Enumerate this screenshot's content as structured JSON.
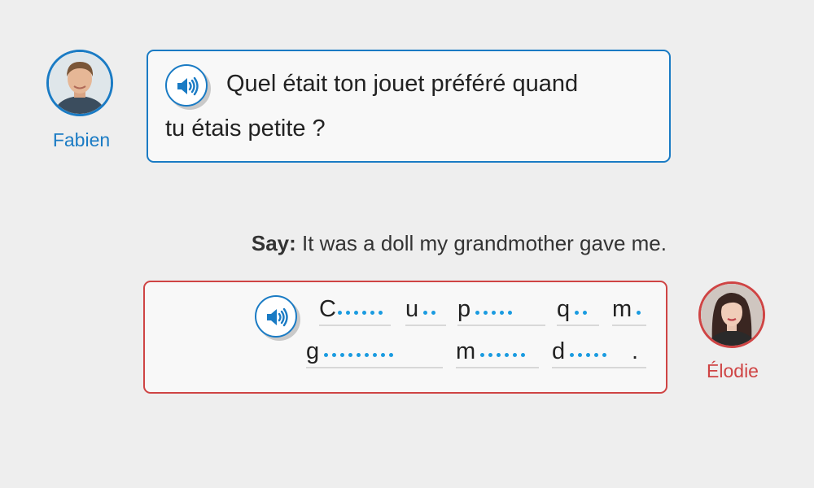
{
  "colors": {
    "tutor": "#1a7bc4",
    "learner": "#cf4444",
    "hint_dot": "#1a9be0"
  },
  "tutor": {
    "name": "Fabien",
    "avatar_icon": "man-portrait",
    "audio_icon": "speaker-icon",
    "question_lines": [
      "Quel était ton jouet préféré quand",
      "tu étais petite ?"
    ]
  },
  "instruction": {
    "label": "Say:",
    "text": "It was a doll my grandmother gave me."
  },
  "learner": {
    "name": "Élodie",
    "avatar_icon": "woman-portrait",
    "audio_icon": "speaker-icon",
    "answer_words": [
      {
        "first": "C",
        "dots": 6,
        "punct": ""
      },
      {
        "first": "u",
        "dots": 2,
        "punct": ""
      },
      {
        "first": "p",
        "dots": 5,
        "punct": ""
      },
      {
        "first": "q",
        "dots": 2,
        "punct": ""
      },
      {
        "first": "m",
        "dots": 1,
        "punct": ""
      },
      {
        "first": "g",
        "dots": 9,
        "punct": ""
      },
      {
        "first": "m",
        "dots": 6,
        "punct": ""
      },
      {
        "first": "d",
        "dots": 5,
        "punct": "."
      }
    ]
  }
}
